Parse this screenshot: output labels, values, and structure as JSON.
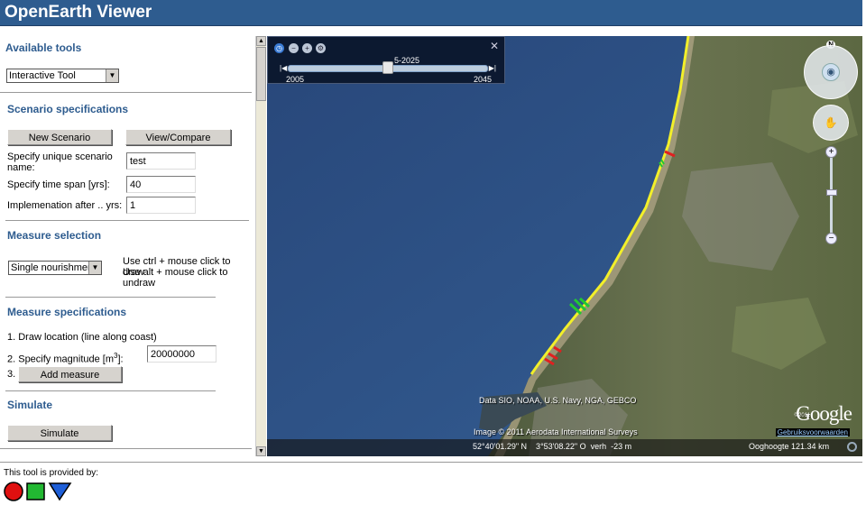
{
  "app": {
    "title": "OpenEarth Viewer"
  },
  "sidebar": {
    "available_tools": {
      "heading": "Available tools",
      "tool_select": "Interactive Tool"
    },
    "scenario": {
      "heading": "Scenario specifications",
      "new_button": "New Scenario",
      "view_button": "View/Compare",
      "name_label": "Specify unique scenario name:",
      "name_value": "test",
      "span_label": "Specify time span [yrs]:",
      "span_value": "40",
      "impl_label": "Implemenation after .. yrs:",
      "impl_value": "1"
    },
    "measure_selection": {
      "heading": "Measure selection",
      "select_value": "Single nourishment",
      "hint_draw": "Use ctrl + mouse click to draw",
      "hint_undraw": "Use alt + mouse click to undraw"
    },
    "measure_specs": {
      "heading": "Measure specifications",
      "step1": "1. Draw location (line along coast)",
      "step2_prefix": "2. Specify magnitude [m",
      "step2_sup": "3",
      "step2_suffix": "]:",
      "magnitude_value": "20000000",
      "step3": "3.",
      "add_button": "Add measure"
    },
    "simulate": {
      "heading": "Simulate",
      "button": "Simulate"
    }
  },
  "map": {
    "timeline": {
      "current": "5-2025",
      "start": "2005",
      "end": "2045",
      "slider_fraction": 0.5
    },
    "attribution_data": "Data SIO, NOAA, U.S. Navy, NGA, GEBCO",
    "attribution_image": "Image © 2011 Aerodata International Surveys",
    "copyright_small": "©2011",
    "google_logo": "Google",
    "terms_link": "Gebruiksvoorwaarden",
    "status_coords": "52°40'01.29\" N    3°53'08.22\" O  verh  -23 m",
    "status_eye": "Ooghoogte   121.34 km",
    "compass_n": "N",
    "colors": {
      "coast_line": "#f2ef2a",
      "measure_green": "#22c832",
      "measure_red": "#e02020"
    }
  },
  "footer": {
    "provided_by": "This tool is provided by:"
  }
}
